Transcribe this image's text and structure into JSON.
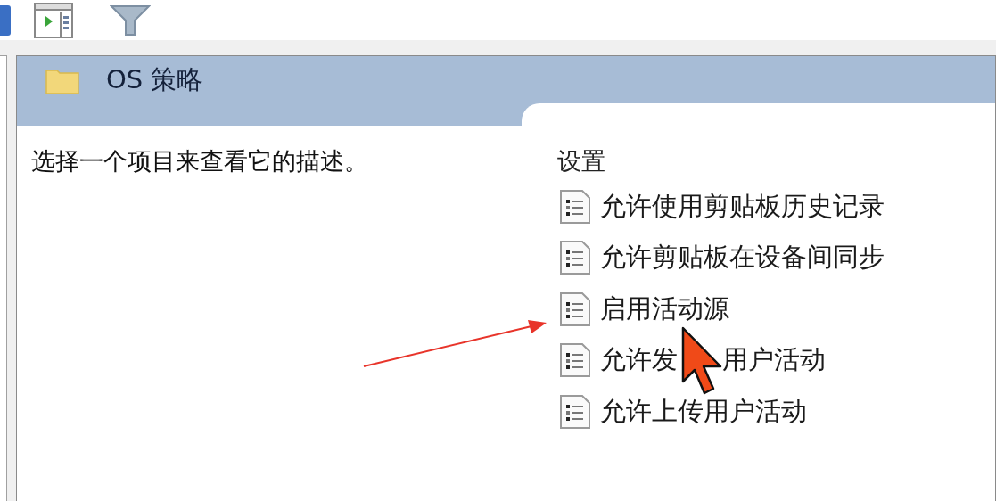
{
  "panel": {
    "title": "OS 策略",
    "description": "选择一个项目来查看它的描述。"
  },
  "settings": {
    "heading": "设置",
    "items": [
      {
        "label": "允许使用剪贴板历史记录"
      },
      {
        "label": "允许剪贴板在设备间同步"
      },
      {
        "label": "启用活动源"
      },
      {
        "label": "允许发",
        "label_after_cursor": "用户活动"
      },
      {
        "label": "允许上传用户活动"
      }
    ]
  }
}
